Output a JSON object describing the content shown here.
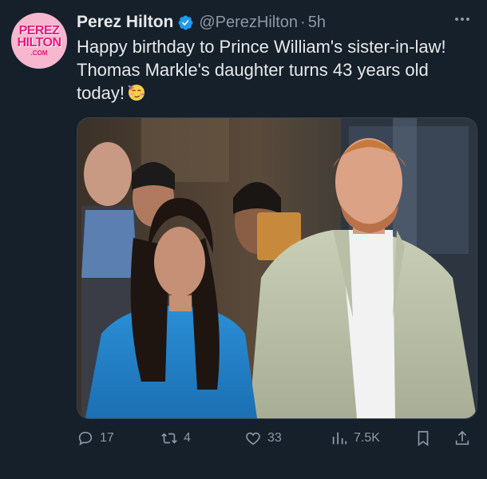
{
  "author": {
    "display_name": "Perez Hilton",
    "handle": "@PerezHilton",
    "separator": "·",
    "time_ago": "5h",
    "verified": true,
    "avatar_text": [
      "PEREZ",
      "HILTON",
      ".COM"
    ]
  },
  "tweet": {
    "text": "Happy birthday to Prince William's sister-in-law! Thomas Markle's daughter turns 43 years old today!",
    "emoji_icon": "partying-face-icon"
  },
  "media": {
    "type": "photo",
    "icon": "photo-of-couple"
  },
  "actions": {
    "replies": "17",
    "reposts": "4",
    "likes": "33",
    "views": "7.5K"
  },
  "colors": {
    "background": "#15202b",
    "primary_text": "#e7e9ea",
    "secondary_text": "#8b98a5",
    "verified": "#1d9bf0",
    "brand_pink": "#e8157c"
  }
}
